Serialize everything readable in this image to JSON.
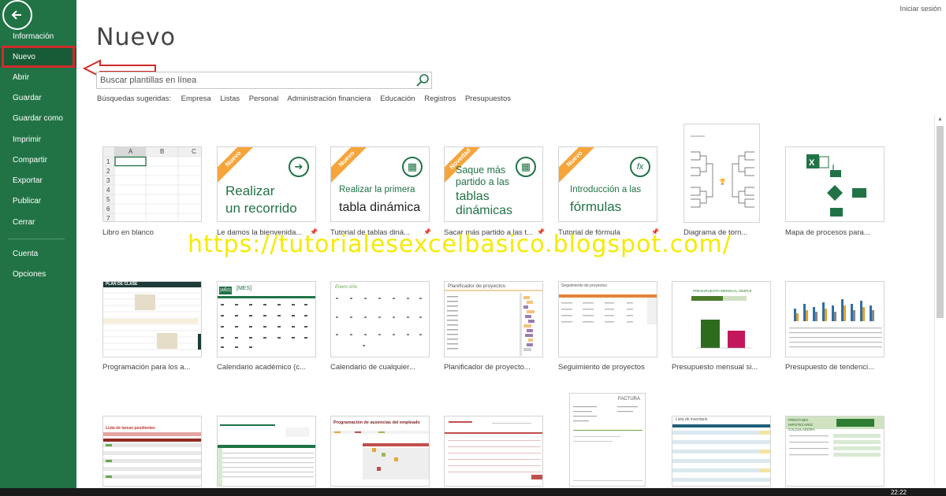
{
  "header": {
    "sign_in": "Iniciar sesión",
    "page_title": "Nuevo"
  },
  "sidebar": {
    "items": [
      {
        "label": "Información"
      },
      {
        "label": "Nuevo"
      },
      {
        "label": "Abrir"
      },
      {
        "label": "Guardar"
      },
      {
        "label": "Guardar como"
      },
      {
        "label": "Imprimir"
      },
      {
        "label": "Compartir"
      },
      {
        "label": "Exportar"
      },
      {
        "label": "Publicar"
      },
      {
        "label": "Cerrar"
      },
      {
        "label": "Cuenta"
      },
      {
        "label": "Opciones"
      }
    ],
    "active": "Nuevo"
  },
  "search": {
    "placeholder": "Buscar plantillas en línea",
    "suggested_label": "Búsquedas sugeridas:",
    "suggestions": [
      "Empresa",
      "Listas",
      "Personal",
      "Administración financiera",
      "Educación",
      "Registros",
      "Presupuestos"
    ]
  },
  "templates": [
    {
      "label": "Libro en blanco"
    },
    {
      "label": "Le damos la bienvenida...",
      "badge": "Nuevo",
      "text1": "Realizar",
      "text2": "un recorrido"
    },
    {
      "label": "Tutorial de tablas diná...",
      "badge": "Nuevo",
      "text1": "Realizar la primera",
      "text2": "tabla dinámica"
    },
    {
      "label": "Sacar más partido a las t...",
      "badge": "Novedad",
      "text1": "Saque más",
      "text2": "partido a las",
      "text3": "tablas",
      "text4": "dinámicas"
    },
    {
      "label": "Tutorial de fórmula",
      "badge": "Nuevo",
      "text1": "Introducción a las",
      "text2": "fórmulas"
    },
    {
      "label": "Diagrama de torn..."
    },
    {
      "label": "Mapa de procesos para..."
    },
    {
      "label": "Programación para los a..."
    },
    {
      "label": "Calendario académico (c..."
    },
    {
      "label": "Calendario de cualquier..."
    },
    {
      "label": "Planificador de proyecto..."
    },
    {
      "label": "Seguimiento de proyectos"
    },
    {
      "label": "Presupuesto mensual si..."
    },
    {
      "label": "Presupuesto de tendenci..."
    }
  ],
  "spreadsheet": {
    "columns": [
      "A",
      "B",
      "C"
    ],
    "rows": [
      "1",
      "2",
      "3",
      "4",
      "5",
      "6",
      "7"
    ]
  },
  "thumb_text": {
    "plan_clase": "PLAN DE CLASE",
    "calendar_year": "[AÑO]",
    "calendar_month": "[MES]",
    "enero": "Enero Año",
    "planificador": "Planificador de proyectos",
    "seguimiento": "Seguimiento de proyectos",
    "presupuesto": "PRESUPUESTO MENSUAL SIMPLE",
    "lista_tareas": "Lista de tareas pendientes",
    "ausencias": "Programación de ausencias del empleado",
    "factura": "FACTURA",
    "inventario": "Lista de inventario",
    "prestamo": "PRÉSTAMO HIPOTECARIO CALCULADORA"
  },
  "watermark": "https://tutorialesexcelbasico.blogspot.com/",
  "taskbar": {
    "clock": "22:22"
  },
  "colors": {
    "excel_green": "#217346",
    "active_green": "#185c37",
    "ribbon_orange": "#f6a53b",
    "highlight_red": "#d02b2b",
    "watermark_yellow": "#f5ea00"
  }
}
